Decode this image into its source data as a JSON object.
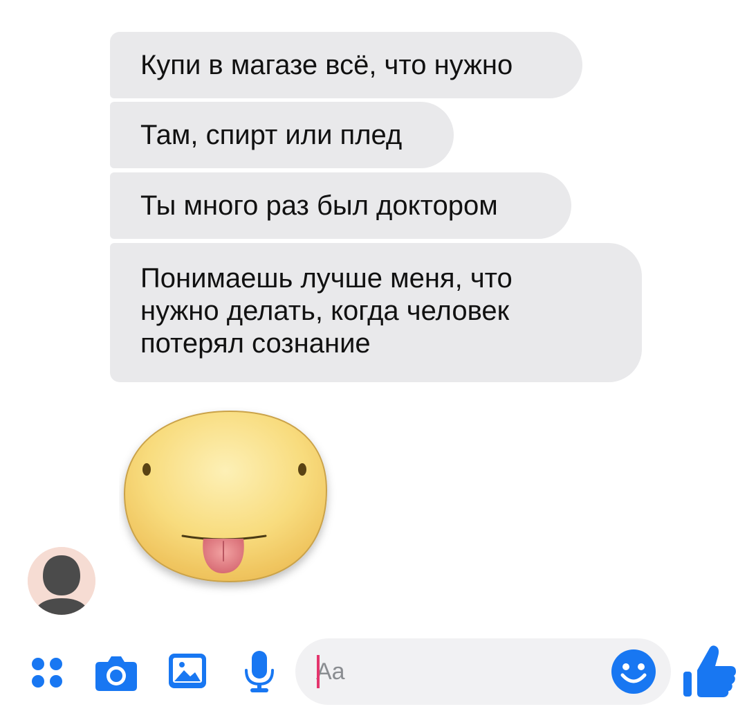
{
  "messages": [
    {
      "text": "Купи в магазе всё, что нужно"
    },
    {
      "text": "Там, спирт или плед"
    },
    {
      "text": "Ты много раз был доктором"
    },
    {
      "text": "Понимаешь лучше меня, что\nнужно делать, когда человек\nпотерял сознание"
    }
  ],
  "sticker": {
    "name": "tongue-out-face-sticker"
  },
  "composer": {
    "placeholder": "Aa"
  },
  "toolbar": {
    "icons": [
      "apps-icon",
      "camera-icon",
      "gallery-icon",
      "microphone-icon",
      "emoji-icon",
      "thumbs-up-icon"
    ]
  },
  "colors": {
    "accent": "#1877f2",
    "bubble": "#e9e9eb",
    "caret": "#e4356d"
  }
}
